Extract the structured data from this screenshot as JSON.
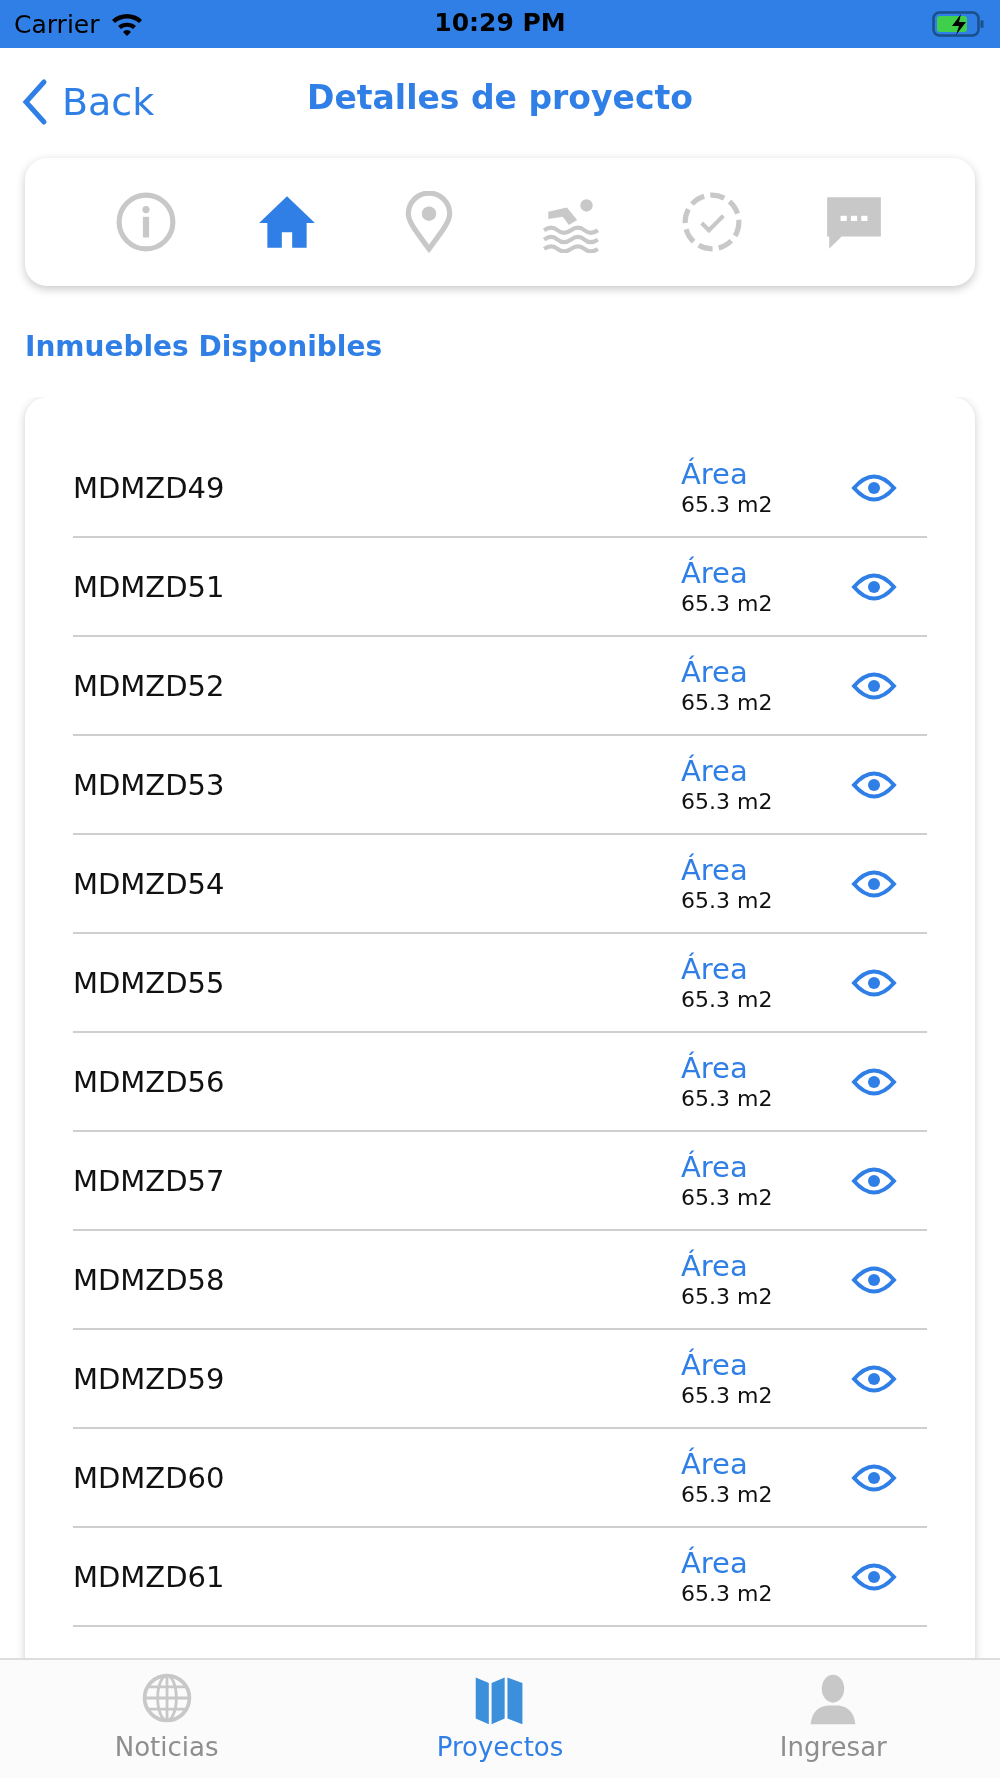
{
  "status_bar": {
    "carrier": "Carrier",
    "time": "10:29 PM",
    "charging": true
  },
  "header": {
    "back": "Back",
    "title": "Detalles de proyecto"
  },
  "section_tabs": [
    {
      "selected": false
    },
    {
      "selected": true
    },
    {
      "selected": false
    },
    {
      "selected": false
    },
    {
      "selected": false
    },
    {
      "selected": false
    }
  ],
  "section_title": "Inmuebles Disponibles",
  "units": [
    {
      "code": "MDMZD49",
      "area_label": "Área",
      "area": "65.3 m2"
    },
    {
      "code": "MDMZD51",
      "area_label": "Área",
      "area": "65.3 m2"
    },
    {
      "code": "MDMZD52",
      "area_label": "Área",
      "area": "65.3 m2"
    },
    {
      "code": "MDMZD53",
      "area_label": "Área",
      "area": "65.3 m2"
    },
    {
      "code": "MDMZD54",
      "area_label": "Área",
      "area": "65.3 m2"
    },
    {
      "code": "MDMZD55",
      "area_label": "Área",
      "area": "65.3 m2"
    },
    {
      "code": "MDMZD56",
      "area_label": "Área",
      "area": "65.3 m2"
    },
    {
      "code": "MDMZD57",
      "area_label": "Área",
      "area": "65.3 m2"
    },
    {
      "code": "MDMZD58",
      "area_label": "Área",
      "area": "65.3 m2"
    },
    {
      "code": "MDMZD59",
      "area_label": "Área",
      "area": "65.3 m2"
    },
    {
      "code": "MDMZD60",
      "area_label": "Área",
      "area": "65.3 m2"
    },
    {
      "code": "MDMZD61",
      "area_label": "Área",
      "area": "65.3 m2"
    }
  ],
  "tab_bar": [
    {
      "label": "Noticias",
      "selected": false
    },
    {
      "label": "Proyectos",
      "selected": true
    },
    {
      "label": "Ingresar",
      "selected": false
    }
  ]
}
